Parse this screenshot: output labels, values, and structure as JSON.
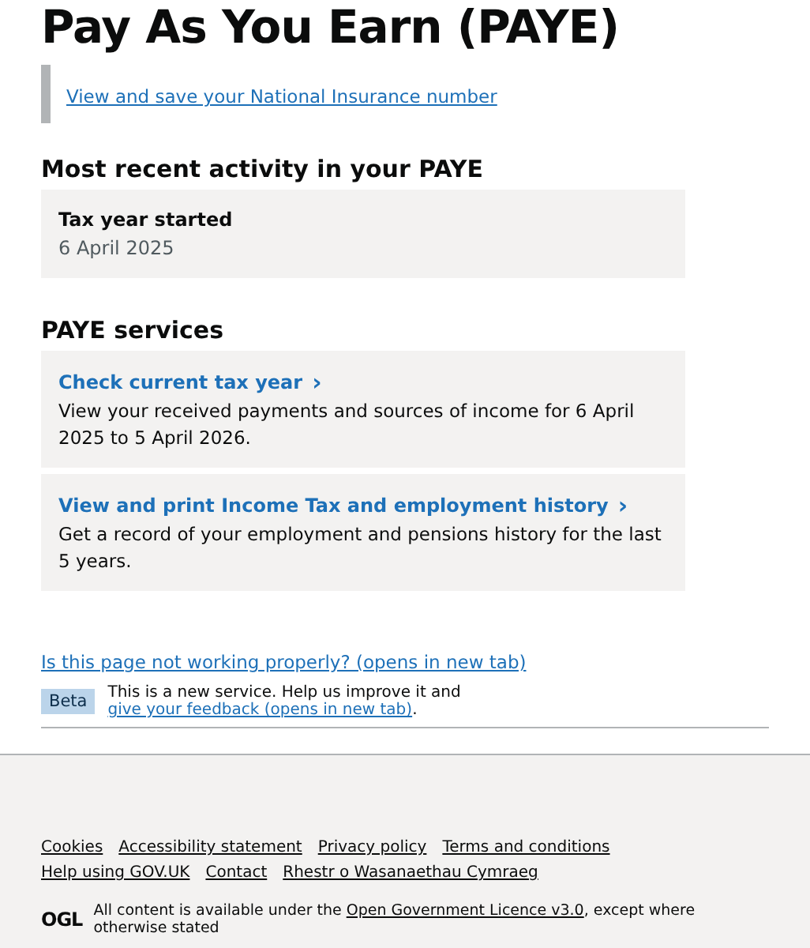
{
  "title": "Pay As You Earn (PAYE)",
  "inset_link": "View and save your National Insurance number",
  "recent": {
    "heading": "Most recent activity in your PAYE",
    "items": [
      {
        "label": "Tax year started",
        "value": "6 April 2025"
      }
    ]
  },
  "services": {
    "heading": "PAYE services",
    "items": [
      {
        "link": "Check current tax year",
        "arrow": "›",
        "description": "View your received payments and sources of income for 6 April 2025 to 5 April 2026."
      },
      {
        "link": "View and print Income Tax and employment history",
        "arrow": "›",
        "description": "Get a record of your employment and pensions history for the last 5 years."
      }
    ]
  },
  "problem_link": "Is this page not working properly? (opens in new tab)",
  "phase_banner": {
    "tag": "Beta",
    "text_before": "This is a new service. Help us improve it and ",
    "link": "give your feedback (opens in new tab)",
    "text_after": "."
  },
  "footer": {
    "links": [
      "Cookies",
      "Accessibility statement",
      "Privacy policy",
      "Terms and conditions",
      "Help using GOV.UK",
      "Contact",
      "Rhestr o Wasanaethau Cymraeg"
    ],
    "logo": "OGL",
    "licence_before": "All content is available under the ",
    "licence_link": "Open Government Licence v3.0",
    "licence_after": ", except where otherwise stated"
  }
}
